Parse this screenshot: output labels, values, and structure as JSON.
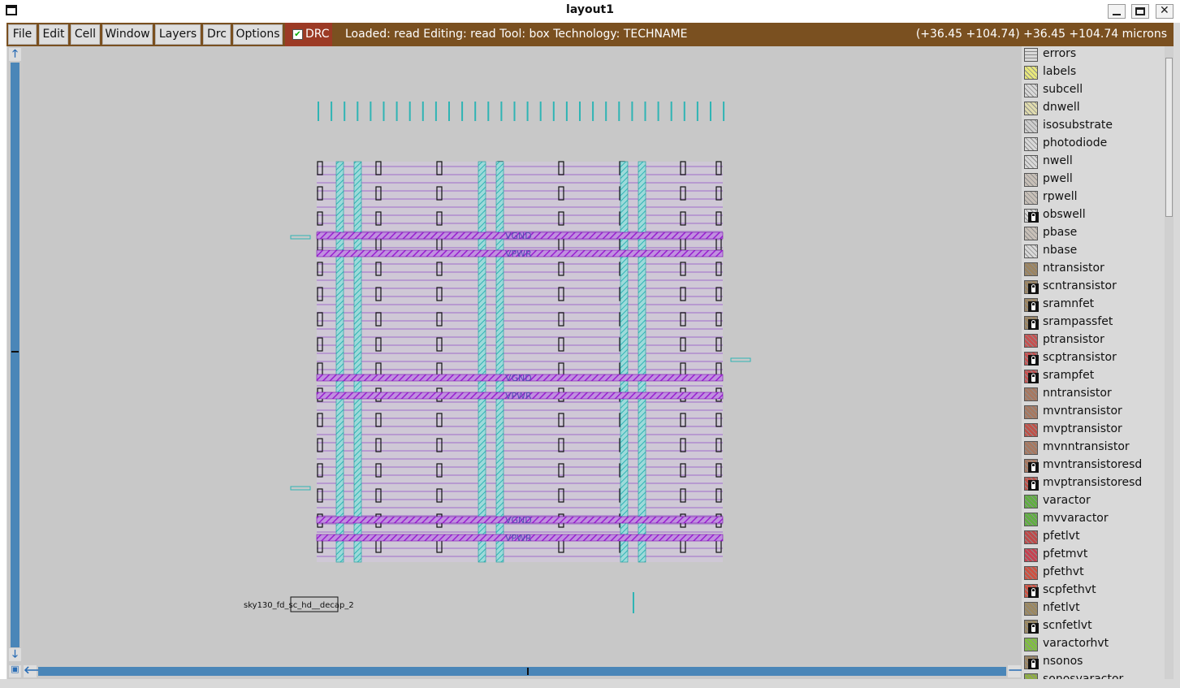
{
  "window": {
    "title": "layout1",
    "icon": "app-menu-icon"
  },
  "menu": [
    "File",
    "Edit",
    "Cell",
    "Window",
    "Layers",
    "Drc",
    "Options"
  ],
  "drc": {
    "label": "DRC",
    "checked": true
  },
  "status": "Loaded: read Editing: read Tool: box  Technology: TECHNAME",
  "coords": "(+36.45 +104.74) +36.45 +104.74 microns",
  "colors": {
    "toolbar": "#7a5020",
    "drc": "#9c3a25",
    "canvas": "#c8c8c8",
    "scrollbar": "#4a86b8"
  },
  "canvas": {
    "net_labels": [
      "VGND",
      "VPWR",
      "VGND",
      "VPWR",
      "VGND",
      "VPWR"
    ],
    "cell_label": "sky130_fd_sc_hd__decap_2"
  },
  "layers": [
    {
      "name": "errors",
      "locked": false
    },
    {
      "name": "labels",
      "locked": false
    },
    {
      "name": "subcell",
      "locked": false
    },
    {
      "name": "dnwell",
      "locked": false
    },
    {
      "name": "isosubstrate",
      "locked": false
    },
    {
      "name": "photodiode",
      "locked": false
    },
    {
      "name": "nwell",
      "locked": false
    },
    {
      "name": "pwell",
      "locked": false
    },
    {
      "name": "rpwell",
      "locked": false
    },
    {
      "name": "obswell",
      "locked": true
    },
    {
      "name": "pbase",
      "locked": false
    },
    {
      "name": "nbase",
      "locked": false
    },
    {
      "name": "ntransistor",
      "locked": false
    },
    {
      "name": "scntransistor",
      "locked": true
    },
    {
      "name": "sramnfet",
      "locked": true
    },
    {
      "name": "srampassfet",
      "locked": true
    },
    {
      "name": "ptransistor",
      "locked": false
    },
    {
      "name": "scptransistor",
      "locked": true
    },
    {
      "name": "srampfet",
      "locked": true
    },
    {
      "name": "nntransistor",
      "locked": false
    },
    {
      "name": "mvntransistor",
      "locked": false
    },
    {
      "name": "mvptransistor",
      "locked": false
    },
    {
      "name": "mvnntransistor",
      "locked": false
    },
    {
      "name": "mvntransistoresd",
      "locked": true
    },
    {
      "name": "mvptransistoresd",
      "locked": true
    },
    {
      "name": "varactor",
      "locked": false
    },
    {
      "name": "mvvaractor",
      "locked": false
    },
    {
      "name": "pfetlvt",
      "locked": false
    },
    {
      "name": "pfetmvt",
      "locked": false
    },
    {
      "name": "pfethvt",
      "locked": false
    },
    {
      "name": "scpfethvt",
      "locked": true
    },
    {
      "name": "nfetlvt",
      "locked": false
    },
    {
      "name": "scnfetlvt",
      "locked": true
    },
    {
      "name": "varactorhvt",
      "locked": false
    },
    {
      "name": "nsonos",
      "locked": true
    },
    {
      "name": "sonosvaractor",
      "locked": false
    }
  ],
  "layer_colors": [
    "#d9d9d9",
    "#e8e87a",
    "#d9d9d9",
    "#e0dcae",
    "#cfcfcf",
    "#d9d9d9",
    "#d9d9d9",
    "#c8c0b8",
    "#c8c0b8",
    "#d9d9d9",
    "#c8c0b8",
    "#d9d9d9",
    "#9c8460",
    "#9c8460",
    "#9c8460",
    "#9c8460",
    "#c85050",
    "#c85050",
    "#c85050",
    "#a87860",
    "#a87860",
    "#c05048",
    "#a87860",
    "#a87860",
    "#c05048",
    "#60b040",
    "#60b040",
    "#c04848",
    "#c84050",
    "#d05040",
    "#d05040",
    "#9c8860",
    "#9c8860",
    "#80c040",
    "#9c8460",
    "#90b040"
  ]
}
